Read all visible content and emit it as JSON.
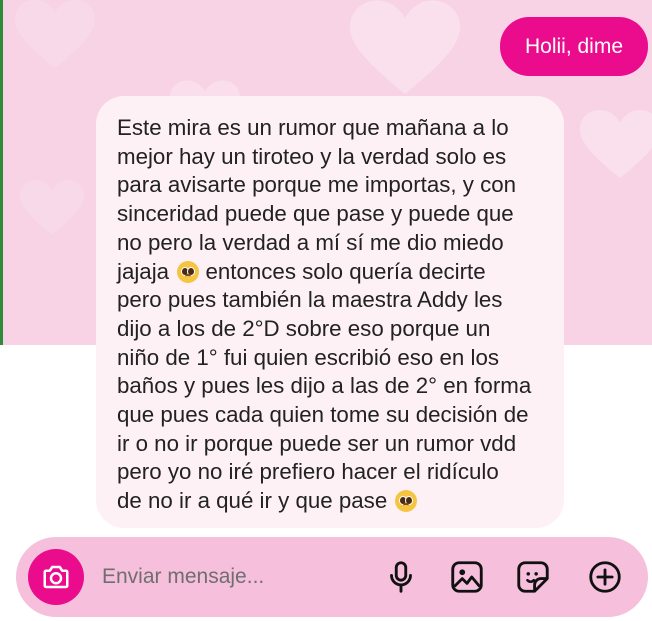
{
  "chat": {
    "outgoing_message": "Holii, dime",
    "incoming_message_lines": [
      "Este mira es un rumor que mañana a lo",
      "mejor hay un tiroteo y la verdad solo es",
      "para avisarte porque me importas, y con",
      "sinceridad puede que pase y puede que",
      "no pero la verdad a mí sí me dio miedo",
      "jajaja",
      "entonces solo quería decirte",
      "pero pues también la maestra Addy les",
      "dijo a los de 2°D sobre eso porque un",
      "niño de 1° fui quien escribió eso en los",
      "baños y pues les dijo a las de 2° en forma",
      "que pues cada quien tome su decisión de",
      "ir o no ir porque puede ser un rumor vdd",
      "pero yo no iré prefiero hacer el ridículo",
      "de no ir a qué ir y que pase"
    ],
    "emoji_icon": "pleading-face-emoji"
  },
  "composer": {
    "placeholder": "Enviar mensaje...",
    "icons": [
      "camera-icon",
      "microphone-icon",
      "image-icon",
      "sticker-icon",
      "add-circle-icon"
    ]
  },
  "colors": {
    "accent": "#ea0c8c",
    "chat_background": "#f8d3e6",
    "incoming_bubble": "#fdf1f5",
    "composer_background": "#f6bfdc"
  }
}
